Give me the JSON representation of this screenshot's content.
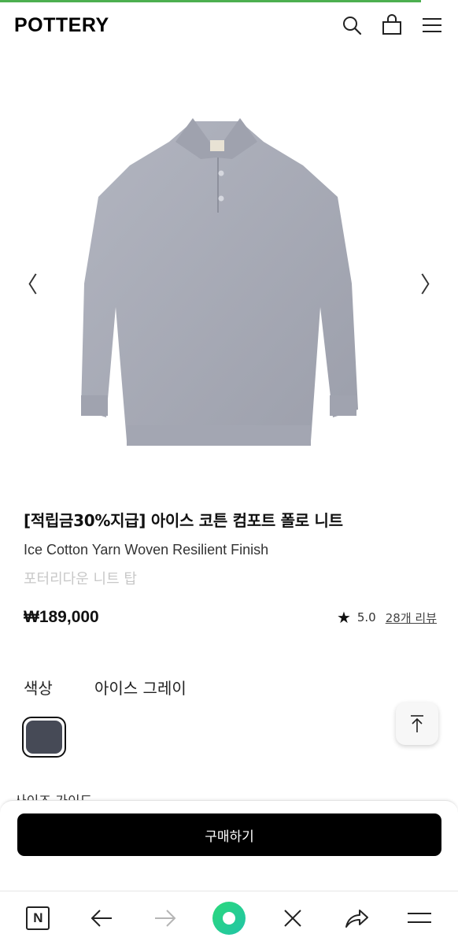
{
  "page_load": {
    "progress_percent": 92,
    "color": "#4caf50"
  },
  "header": {
    "logo": "POTTERY",
    "icons": [
      "search-icon",
      "shopping-bag-icon",
      "menu-icon"
    ]
  },
  "gallery": {
    "prev_glyph": "〈",
    "next_glyph": "〉",
    "product_color": "#a8abb6"
  },
  "product": {
    "title": "[적립금30%지급] 아이스 코튼 컴포트 폴로 니트",
    "subtitle": "Ice Cotton Yarn Woven Resilient Finish",
    "category": "포터리다운 니트 탑",
    "price": "₩189,000",
    "rating": "5.0",
    "reviews": "28개 리뷰"
  },
  "options": {
    "color_label": "색상",
    "color_value": "아이스 그레이",
    "swatch_color": "#464a56"
  },
  "size_guide": "사이즈 가이드",
  "buy_button": "구매하기",
  "browser": {
    "n_label": "N",
    "icons": [
      "naver-icon",
      "back-arrow-icon",
      "forward-arrow-icon",
      "green-dot-icon",
      "close-icon",
      "share-icon",
      "menu-icon"
    ]
  }
}
